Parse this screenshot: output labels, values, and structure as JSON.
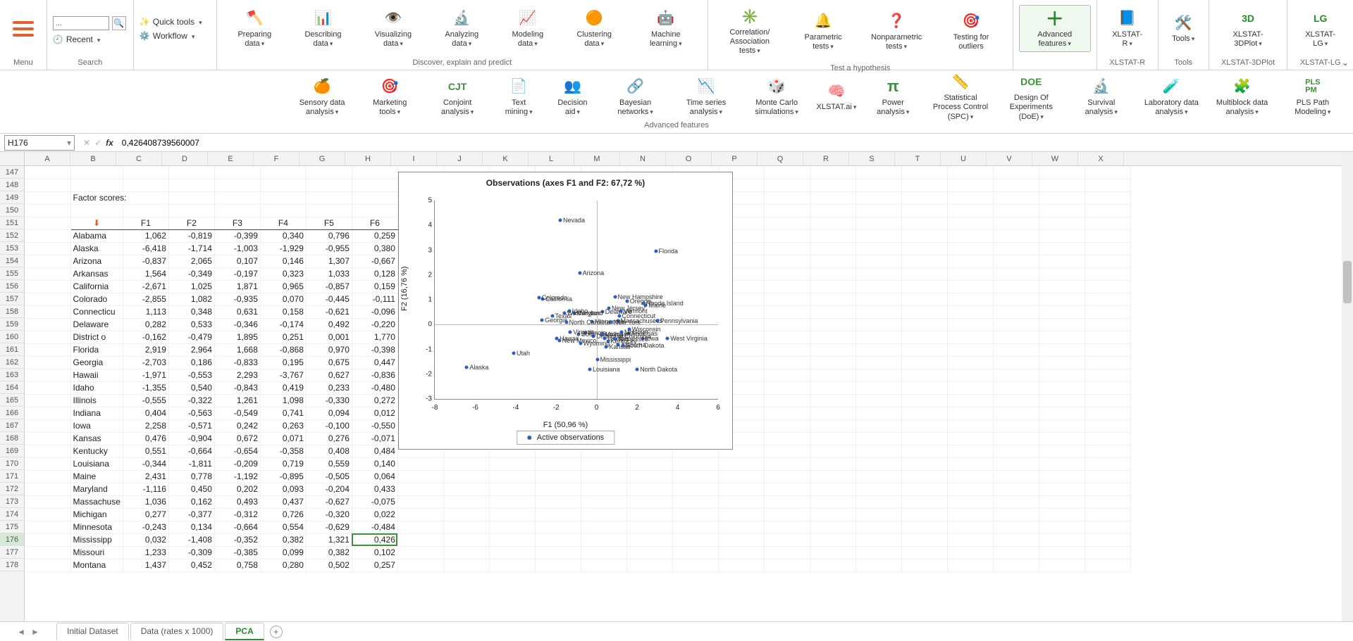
{
  "ribbon": {
    "menu_label": "Menu",
    "search_label": "Search",
    "search_placeholder": "...",
    "recent_label": "Recent",
    "quick_tools_label": "Quick tools",
    "workflow_label": "Workflow",
    "groups": {
      "discover": {
        "label": "Discover, explain and predict"
      },
      "hypothesis": {
        "label": "Test a hypothesis"
      },
      "r": {
        "label": "XLSTAT-R"
      },
      "tools": {
        "label": "Tools"
      },
      "plot3d": {
        "label": "XLSTAT-3DPlot"
      },
      "lg": {
        "label": "XLSTAT-LG"
      }
    },
    "buttons": {
      "preparing": "Preparing data",
      "describing": "Describing data",
      "visualizing": "Visualizing data",
      "analyzing": "Analyzing data",
      "modeling": "Modeling data",
      "clustering": "Clustering data",
      "ml": "Machine learning",
      "correlation": "Correlation/ Association tests",
      "parametric": "Parametric tests",
      "nonparam": "Nonparametric tests",
      "outliers": "Testing for outliers",
      "advanced": "Advanced features",
      "r_btn": "XLSTAT-R",
      "tools_btn": "Tools",
      "plot3d_btn": "XLSTAT-3DPlot",
      "lg_btn": "XLSTAT-LG"
    }
  },
  "sub_ribbon": {
    "label": "Advanced features",
    "buttons": {
      "sensory": "Sensory data analysis",
      "marketing": "Marketing tools",
      "conjoint": "Conjoint analysis",
      "textmining": "Text mining",
      "decision": "Decision aid",
      "bayesian": "Bayesian networks",
      "timeseries": "Time series analysis",
      "montecarlo": "Monte Carlo simulations",
      "ai": "XLSTAT.ai",
      "power": "Power analysis",
      "spc": "Statistical Process Control (SPC)",
      "doe": "Design Of Experiments (DoE)",
      "survival": "Survival analysis",
      "lab": "Laboratory data analysis",
      "multiblock": "Multiblock data analysis",
      "pls": "PLS Path Modeling"
    }
  },
  "formula_bar": {
    "namebox": "H176",
    "value": "0,426408739560007"
  },
  "columns": [
    "A",
    "B",
    "C",
    "D",
    "E",
    "F",
    "G"
  ],
  "row_start": 147,
  "section_title": "Factor scores:",
  "table_headers": [
    "",
    "F1",
    "F2",
    "F3",
    "F4",
    "F5",
    "F6"
  ],
  "rows": [
    {
      "r": 152,
      "label": "Alabama",
      "v": [
        "1,062",
        "-0,819",
        "-0,399",
        "0,340",
        "0,796",
        "0,259"
      ]
    },
    {
      "r": 153,
      "label": "Alaska",
      "v": [
        "-6,418",
        "-1,714",
        "-1,003",
        "-1,929",
        "-0,955",
        "0,380"
      ]
    },
    {
      "r": 154,
      "label": "Arizona",
      "v": [
        "-0,837",
        "2,065",
        "0,107",
        "0,146",
        "1,307",
        "-0,667"
      ]
    },
    {
      "r": 155,
      "label": "Arkansas",
      "v": [
        "1,564",
        "-0,349",
        "-0,197",
        "0,323",
        "1,033",
        "0,128"
      ]
    },
    {
      "r": 156,
      "label": "California",
      "v": [
        "-2,671",
        "1,025",
        "1,871",
        "0,965",
        "-0,857",
        "0,159"
      ]
    },
    {
      "r": 157,
      "label": "Colorado",
      "v": [
        "-2,855",
        "1,082",
        "-0,935",
        "0,070",
        "-0,445",
        "-0,111"
      ]
    },
    {
      "r": 158,
      "label": "Connecticut",
      "v": [
        "1,113",
        "0,348",
        "0,631",
        "0,158",
        "-0,621",
        "-0,096"
      ]
    },
    {
      "r": 159,
      "label": "Delaware",
      "v": [
        "0,282",
        "0,533",
        "-0,346",
        "-0,174",
        "0,492",
        "-0,220"
      ]
    },
    {
      "r": 160,
      "label": "District of",
      "v": [
        "-0,162",
        "-0,479",
        "1,895",
        "0,251",
        "0,001",
        "1,770"
      ]
    },
    {
      "r": 161,
      "label": "Florida",
      "v": [
        "2,919",
        "2,964",
        "1,668",
        "-0,868",
        "0,970",
        "-0,398"
      ]
    },
    {
      "r": 162,
      "label": "Georgia",
      "v": [
        "-2,703",
        "0,186",
        "-0,833",
        "0,195",
        "0,675",
        "0,447"
      ]
    },
    {
      "r": 163,
      "label": "Hawaii",
      "v": [
        "-1,971",
        "-0,553",
        "2,293",
        "-3,767",
        "0,627",
        "-0,836"
      ]
    },
    {
      "r": 164,
      "label": "Idaho",
      "v": [
        "-1,355",
        "0,540",
        "-0,843",
        "0,419",
        "0,233",
        "-0,480"
      ]
    },
    {
      "r": 165,
      "label": "Illinois",
      "v": [
        "-0,555",
        "-0,322",
        "1,261",
        "1,098",
        "-0,330",
        "0,272"
      ]
    },
    {
      "r": 166,
      "label": "Indiana",
      "v": [
        "0,404",
        "-0,563",
        "-0,549",
        "0,741",
        "0,094",
        "0,012"
      ]
    },
    {
      "r": 167,
      "label": "Iowa",
      "v": [
        "2,258",
        "-0,571",
        "0,242",
        "0,263",
        "-0,100",
        "-0,550"
      ]
    },
    {
      "r": 168,
      "label": "Kansas",
      "v": [
        "0,476",
        "-0,904",
        "0,672",
        "0,071",
        "0,276",
        "-0,071"
      ]
    },
    {
      "r": 169,
      "label": "Kentucky",
      "v": [
        "0,551",
        "-0,664",
        "-0,654",
        "-0,358",
        "0,408",
        "0,484"
      ]
    },
    {
      "r": 170,
      "label": "Louisiana",
      "v": [
        "-0,344",
        "-1,811",
        "-0,209",
        "0,719",
        "0,559",
        "0,140"
      ]
    },
    {
      "r": 171,
      "label": "Maine",
      "v": [
        "2,431",
        "0,778",
        "-1,192",
        "-0,895",
        "-0,505",
        "0,064"
      ]
    },
    {
      "r": 172,
      "label": "Maryland",
      "v": [
        "-1,116",
        "0,450",
        "0,202",
        "0,093",
        "-0,204",
        "0,433"
      ]
    },
    {
      "r": 173,
      "label": "Massachusetts",
      "v": [
        "1,036",
        "0,162",
        "0,493",
        "0,437",
        "-0,627",
        "-0,075"
      ]
    },
    {
      "r": 174,
      "label": "Michigan",
      "v": [
        "0,277",
        "-0,377",
        "-0,312",
        "0,726",
        "-0,320",
        "0,022"
      ]
    },
    {
      "r": 175,
      "label": "Minnesota",
      "v": [
        "-0,243",
        "0,134",
        "-0,664",
        "0,554",
        "-0,629",
        "-0,484"
      ]
    },
    {
      "r": 176,
      "label": "Mississippi",
      "v": [
        "0,032",
        "-1,408",
        "-0,352",
        "0,382",
        "1,321",
        "0,426"
      ]
    },
    {
      "r": 177,
      "label": "Missouri",
      "v": [
        "1,233",
        "-0,309",
        "-0,385",
        "0,099",
        "0,382",
        "0,102"
      ]
    },
    {
      "r": 178,
      "label": "Montana",
      "v": [
        "1,437",
        "0,452",
        "0,758",
        "0,280",
        "0,502",
        "0,257"
      ]
    }
  ],
  "selected": {
    "row": 176,
    "col": 6,
    "cell_ref": "H176"
  },
  "chart_data": {
    "type": "scatter",
    "title": "Observations (axes F1 and F2: 67,72 %)",
    "xlabel": "F1 (50,96 %)",
    "ylabel": "F2 (16,76 %)",
    "xlim": [
      -8,
      6
    ],
    "ylim": [
      -3,
      5
    ],
    "legend": "Active observations",
    "points": [
      {
        "name": "Alabama",
        "x": 1.06,
        "y": -0.82
      },
      {
        "name": "Alaska",
        "x": -6.42,
        "y": -1.71
      },
      {
        "name": "Arizona",
        "x": -0.84,
        "y": 2.07
      },
      {
        "name": "Arkansas",
        "x": 1.56,
        "y": -0.35
      },
      {
        "name": "California",
        "x": -2.67,
        "y": 1.03
      },
      {
        "name": "Colorado",
        "x": -2.86,
        "y": 1.08
      },
      {
        "name": "Connecticut",
        "x": 1.11,
        "y": 0.35
      },
      {
        "name": "Delaware",
        "x": 0.28,
        "y": 0.53
      },
      {
        "name": "District of Columbia",
        "x": -0.16,
        "y": -0.48
      },
      {
        "name": "Florida",
        "x": 2.92,
        "y": 2.96
      },
      {
        "name": "Georgia",
        "x": -2.7,
        "y": 0.19
      },
      {
        "name": "Hawaii",
        "x": -1.97,
        "y": -0.55
      },
      {
        "name": "Idaho",
        "x": -1.36,
        "y": 0.54
      },
      {
        "name": "Illinois",
        "x": -0.56,
        "y": -0.32
      },
      {
        "name": "Indiana",
        "x": 0.4,
        "y": -0.56
      },
      {
        "name": "Iowa",
        "x": 2.26,
        "y": -0.57
      },
      {
        "name": "Kansas",
        "x": 0.48,
        "y": -0.9
      },
      {
        "name": "Kentucky",
        "x": 0.55,
        "y": -0.66
      },
      {
        "name": "Louisiana",
        "x": -0.34,
        "y": -1.81
      },
      {
        "name": "Maine",
        "x": 2.43,
        "y": 0.78
      },
      {
        "name": "Maryland",
        "x": -1.12,
        "y": 0.45
      },
      {
        "name": "Massachusetts",
        "x": 1.04,
        "y": 0.16
      },
      {
        "name": "Michigan",
        "x": 0.28,
        "y": -0.38
      },
      {
        "name": "Minnesota",
        "x": -0.24,
        "y": 0.13
      },
      {
        "name": "Mississippi",
        "x": 0.03,
        "y": -1.41
      },
      {
        "name": "Missouri",
        "x": 1.23,
        "y": -0.31
      },
      {
        "name": "Nevada",
        "x": -1.8,
        "y": 4.2
      },
      {
        "name": "New Hampshire",
        "x": 0.9,
        "y": 1.1
      },
      {
        "name": "New Jersey",
        "x": 0.6,
        "y": 0.65
      },
      {
        "name": "New Mexico",
        "x": -1.85,
        "y": -0.65
      },
      {
        "name": "New York",
        "x": 0.7,
        "y": 0.1
      },
      {
        "name": "North Carolina",
        "x": -1.5,
        "y": 0.1
      },
      {
        "name": "North Dakota",
        "x": 2.0,
        "y": -1.8
      },
      {
        "name": "Oregon",
        "x": 1.5,
        "y": 0.95
      },
      {
        "name": "Pennsylvania",
        "x": 3.0,
        "y": 0.15
      },
      {
        "name": "Rhode Island",
        "x": 2.3,
        "y": 0.85
      },
      {
        "name": "South Carolina",
        "x": -0.9,
        "y": -0.4
      },
      {
        "name": "South Dakota",
        "x": 1.3,
        "y": -0.85
      },
      {
        "name": "Tennessee",
        "x": 0.9,
        "y": -0.6
      },
      {
        "name": "Texas",
        "x": -2.2,
        "y": 0.35
      },
      {
        "name": "Utah",
        "x": -4.1,
        "y": -1.15
      },
      {
        "name": "Vermont",
        "x": 1.2,
        "y": 0.55
      },
      {
        "name": "Virginia",
        "x": -1.3,
        "y": -0.3
      },
      {
        "name": "Washington",
        "x": -1.6,
        "y": 0.45
      },
      {
        "name": "West Virginia",
        "x": 3.5,
        "y": -0.55
      },
      {
        "name": "Wisconsin",
        "x": 1.6,
        "y": -0.2
      },
      {
        "name": "Wyoming",
        "x": -0.8,
        "y": -0.75
      }
    ]
  },
  "tabs": {
    "items": [
      "Initial Dataset",
      "Data (rates x 1000)",
      "PCA"
    ],
    "active": 2
  }
}
